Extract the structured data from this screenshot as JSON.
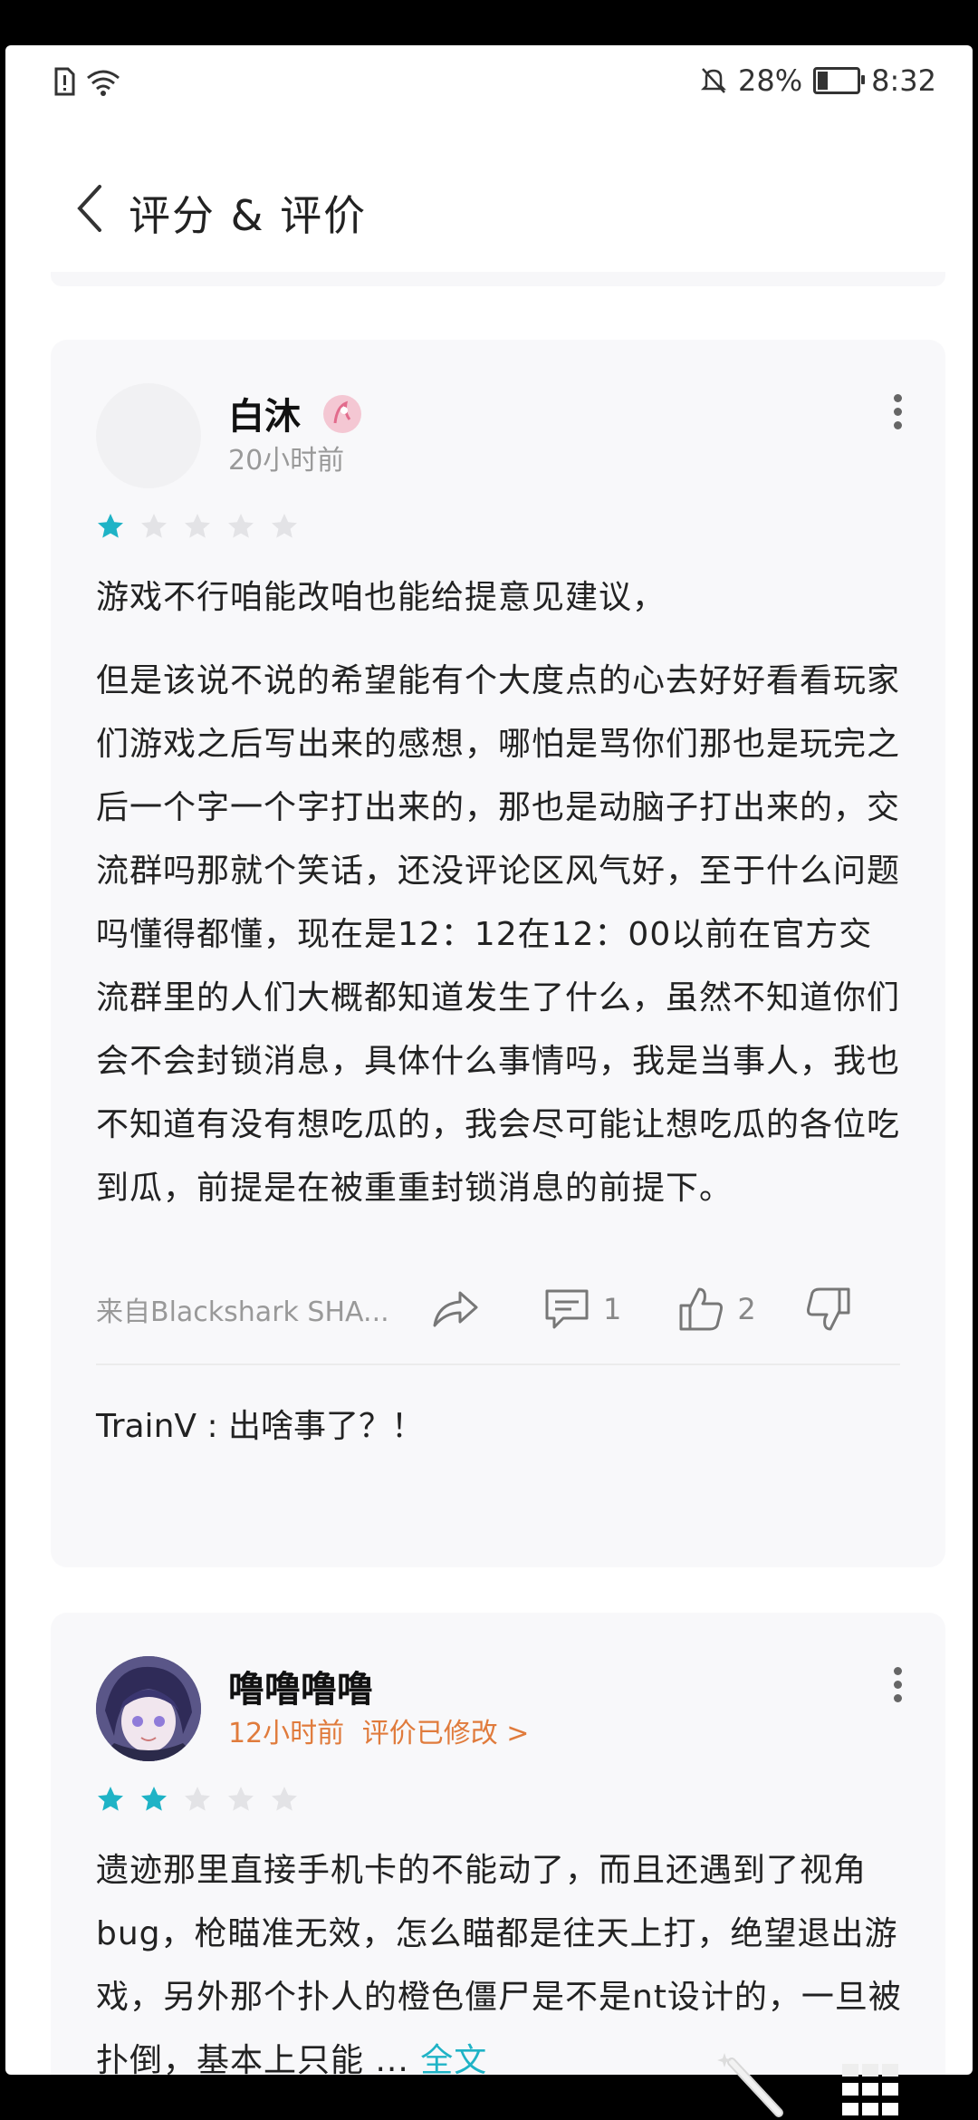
{
  "status_bar": {
    "battery_percent": "28%",
    "time": "8:32",
    "battery_level": 0.28
  },
  "header": {
    "title": "评分 & 评价"
  },
  "reviews": [
    {
      "user": "白沐",
      "time": "20小时前",
      "edited_label": "",
      "rating": 1,
      "para1": "游戏不行咱能改咱也能给提意见建议，",
      "para2": "但是该说不说的希望能有个大度点的心去好好看看玩家们游戏之后写出来的感想，哪怕是骂你们那也是玩完之后一个字一个字打出来的，那也是动脑子打出来的，交流群吗那就个笑话，还没评论区风气好，至于什么问题吗懂得都懂，现在是12：12在12：00以前在官方交流群里的人们大概都知道发生了什么，虽然不知道你们会不会封锁消息，具体什么事情吗，我是当事人，我也不知道有没有想吃瓜的，我会尽可能让想吃瓜的各位吃到瓜，前提是在被重重封锁消息的前提下。",
      "device": "来自Blackshark SHA...",
      "comments": "1",
      "likes": "2",
      "reply": "TrainV : 出啥事了？！"
    },
    {
      "user": "噜噜噜噜",
      "time": "12小时前",
      "edited_label": "评价已修改 >",
      "rating": 2,
      "text": "遗迹那里直接手机卡的不能动了，而且还遇到了视角bug，枪瞄准无效，怎么瞄都是往天上打，绝望退出游戏，另外那个扑人的橙色僵尸是不是nt设计的，一旦被扑倒，基本上只能 ...",
      "more_label": "全文"
    }
  ],
  "colors": {
    "star_on": "#1fb3c6",
    "star_off": "#e3e3e6",
    "accent_orange": "#e07b3c"
  }
}
